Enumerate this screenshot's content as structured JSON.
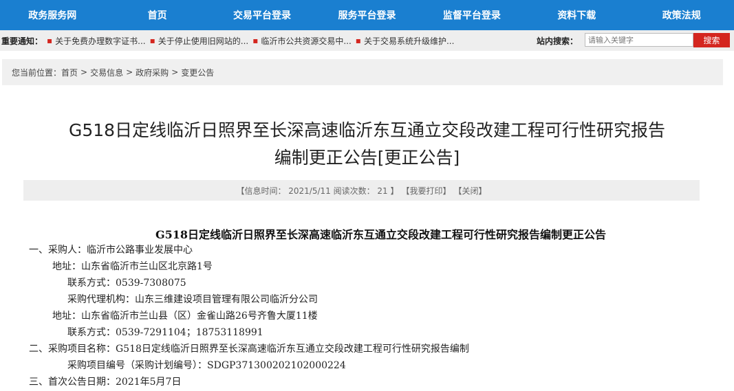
{
  "nav": {
    "items": [
      "政务服务网",
      "首页",
      "交易平台登录",
      "服务平台登录",
      "监督平台登录",
      "资料下载",
      "政策法规"
    ]
  },
  "notice": {
    "label": "重要通知：",
    "items": [
      "关于免费办理数字证书...",
      "关于停止使用旧网站的...",
      "临沂市公共资源交易中...",
      "关于交易系统升级维护..."
    ],
    "search_label": "站内搜索：",
    "search_placeholder": "请输入关键字",
    "search_button": "搜索"
  },
  "breadcrumb": {
    "prefix": "您当前位置：",
    "items": [
      "首页",
      "交易信息",
      "政府采购",
      "变更公告"
    ],
    "separator": ">"
  },
  "article": {
    "title_line1": "G518日定线临沂日照界至长深高速临沂东互通立交段改建工程可行性研究报告",
    "title_line2": "编制更正公告[更正公告]",
    "info": {
      "time_text": "【信息时间： 2021/5/11 阅读次数： 21 】",
      "print": "【我要打印】",
      "close": "【关闭】"
    },
    "body_title": "G518日定线临沂日照界至长深高速临沂东互通立交段改建工程可行性研究报告编制更正公告",
    "lines": [
      "一、采购人：临沂市公路事业发展中心",
      "地址：山东省临沂市兰山区北京路1号",
      "联系方式：0539-7308075",
      "采购代理机构：山东三维建设项目管理有限公司临沂分公司",
      "地址：山东省临沂市兰山县（区）金雀山路26号齐鲁大厦11楼",
      "联系方式：0539-7291104；18753118991",
      "二、采购项目名称：G518日定线临沂日照界至长深高速临沂东互通立交段改建工程可行性研究报告编制",
      "采购项目编号（采购计划编号）：SDGP371300202102000224",
      "三、首次公告日期：2021年5月7日"
    ]
  },
  "colors": {
    "nav_bg": "#1a7fd0",
    "accent_red": "#d4261f"
  }
}
